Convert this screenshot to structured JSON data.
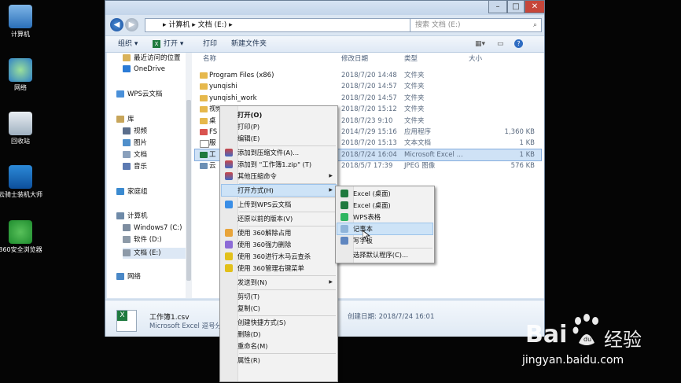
{
  "desktop": {
    "icons": [
      {
        "label": "计算机",
        "name": "computer-desktop-icon"
      },
      {
        "label": "网络",
        "name": "network-desktop-icon"
      },
      {
        "label": "回收站",
        "name": "recycle-bin-icon"
      },
      {
        "label": "云骑士装机大师",
        "name": "yunqishi-icon"
      },
      {
        "label": "360安全浏览器",
        "name": "browser-360-icon"
      }
    ]
  },
  "window": {
    "breadcrumb": [
      "计算机",
      "文档 (E:)"
    ],
    "search_placeholder": "搜索 文档 (E:)",
    "toolbar": {
      "organize": "组织 ▾",
      "open": "打开 ▾",
      "print": "打印",
      "new_folder": "新建文件夹"
    },
    "nav": [
      {
        "label": "最近访问的位置"
      },
      {
        "label": "OneDrive"
      },
      {
        "label": "WPS云文档"
      },
      {
        "label": "库"
      },
      {
        "label": "视频"
      },
      {
        "label": "图片"
      },
      {
        "label": "文档"
      },
      {
        "label": "音乐"
      },
      {
        "label": "家庭组"
      },
      {
        "label": "计算机"
      },
      {
        "label": "Windows7 (C:)"
      },
      {
        "label": "软件 (D:)"
      },
      {
        "label": "文档 (E:)"
      },
      {
        "label": "网络"
      }
    ],
    "columns": {
      "name": "名称",
      "date": "修改日期",
      "type": "类型",
      "size": "大小"
    },
    "files": [
      {
        "name": "Program Files (x86)",
        "date": "2018/7/20 14:48",
        "type": "文件夹",
        "size": ""
      },
      {
        "name": "yunqishi",
        "date": "2018/7/20 14:57",
        "type": "文件夹",
        "size": ""
      },
      {
        "name": "yunqishi_work",
        "date": "2018/7/20 14:57",
        "type": "文件夹",
        "size": ""
      },
      {
        "name": "视频",
        "date": "2018/7/20 15:12",
        "type": "文件夹",
        "size": ""
      },
      {
        "name": "桌",
        "date": "2018/7/23 9:10",
        "type": "文件夹",
        "size": ""
      },
      {
        "name": "FS",
        "date": "2014/7/29 15:16",
        "type": "应用程序",
        "size": "1,360 KB"
      },
      {
        "name": "服",
        "date": "2018/7/20 15:13",
        "type": "文本文档",
        "size": "1 KB"
      },
      {
        "name": "工",
        "date": "2018/7/24 16:04",
        "type": "Microsoft Excel ...",
        "size": "1 KB"
      },
      {
        "name": "云",
        "date": "2018/5/7 17:39",
        "type": "JPEG 图像",
        "size": "576 KB"
      }
    ],
    "details": {
      "filename": "工作簿1.csv",
      "filetype": "Microsoft Excel 逗号分隔",
      "created": "创建日期: 2018/7/24 16:01"
    }
  },
  "context_menu": [
    {
      "label": "打开(O)",
      "bold": true
    },
    {
      "label": "打印(P)"
    },
    {
      "label": "编辑(E)"
    },
    {
      "sep": true
    },
    {
      "label": "添加到压缩文件(A)...",
      "icon": "winrar-icon"
    },
    {
      "label": "添加到 \"工作簿1.zip\" (T)",
      "icon": "winrar-icon"
    },
    {
      "label": "其他压缩命令",
      "icon": "winrar-icon",
      "sub": true
    },
    {
      "sep": true
    },
    {
      "label": "打开方式(H)",
      "sub": true,
      "highlight": true
    },
    {
      "sep": true
    },
    {
      "label": "上传到WPS云文档",
      "icon": "wps-cloud-icon"
    },
    {
      "sep": true
    },
    {
      "label": "还原以前的版本(V)"
    },
    {
      "sep": true
    },
    {
      "label": "使用 360解除占用",
      "icon": "unlock-360-icon"
    },
    {
      "label": "使用 360强力删除",
      "icon": "delete-360-icon"
    },
    {
      "label": "使用 360进行木马云查杀",
      "icon": "scan-360-icon"
    },
    {
      "label": "使用 360管理右键菜单",
      "icon": "manage-360-icon"
    },
    {
      "sep": true
    },
    {
      "label": "发送到(N)",
      "sub": true
    },
    {
      "sep": true
    },
    {
      "label": "剪切(T)"
    },
    {
      "label": "复制(C)"
    },
    {
      "sep": true
    },
    {
      "label": "创建快捷方式(S)"
    },
    {
      "label": "删除(D)"
    },
    {
      "label": "重命名(M)"
    },
    {
      "sep": true
    },
    {
      "label": "属性(R)"
    }
  ],
  "submenu": [
    {
      "label": "Excel (桌面)",
      "icon": "excel-icon"
    },
    {
      "label": "Excel (桌面)",
      "icon": "excel-icon"
    },
    {
      "label": "WPS表格",
      "icon": "wps-sheet-icon"
    },
    {
      "label": "记事本",
      "icon": "notepad-icon",
      "highlight": true
    },
    {
      "label": "写字板",
      "icon": "wordpad-icon"
    },
    {
      "sep": true
    },
    {
      "label": "选择默认程序(C)..."
    }
  ],
  "watermark": {
    "brand": "Bai",
    "brand2": "经验",
    "url": "jingyan.baidu.com"
  },
  "colors": {
    "menu_highlight": "#cde3f7",
    "excel_green": "#1f7a3f",
    "wps_green": "#2db560",
    "folder": "#e6b84c"
  }
}
